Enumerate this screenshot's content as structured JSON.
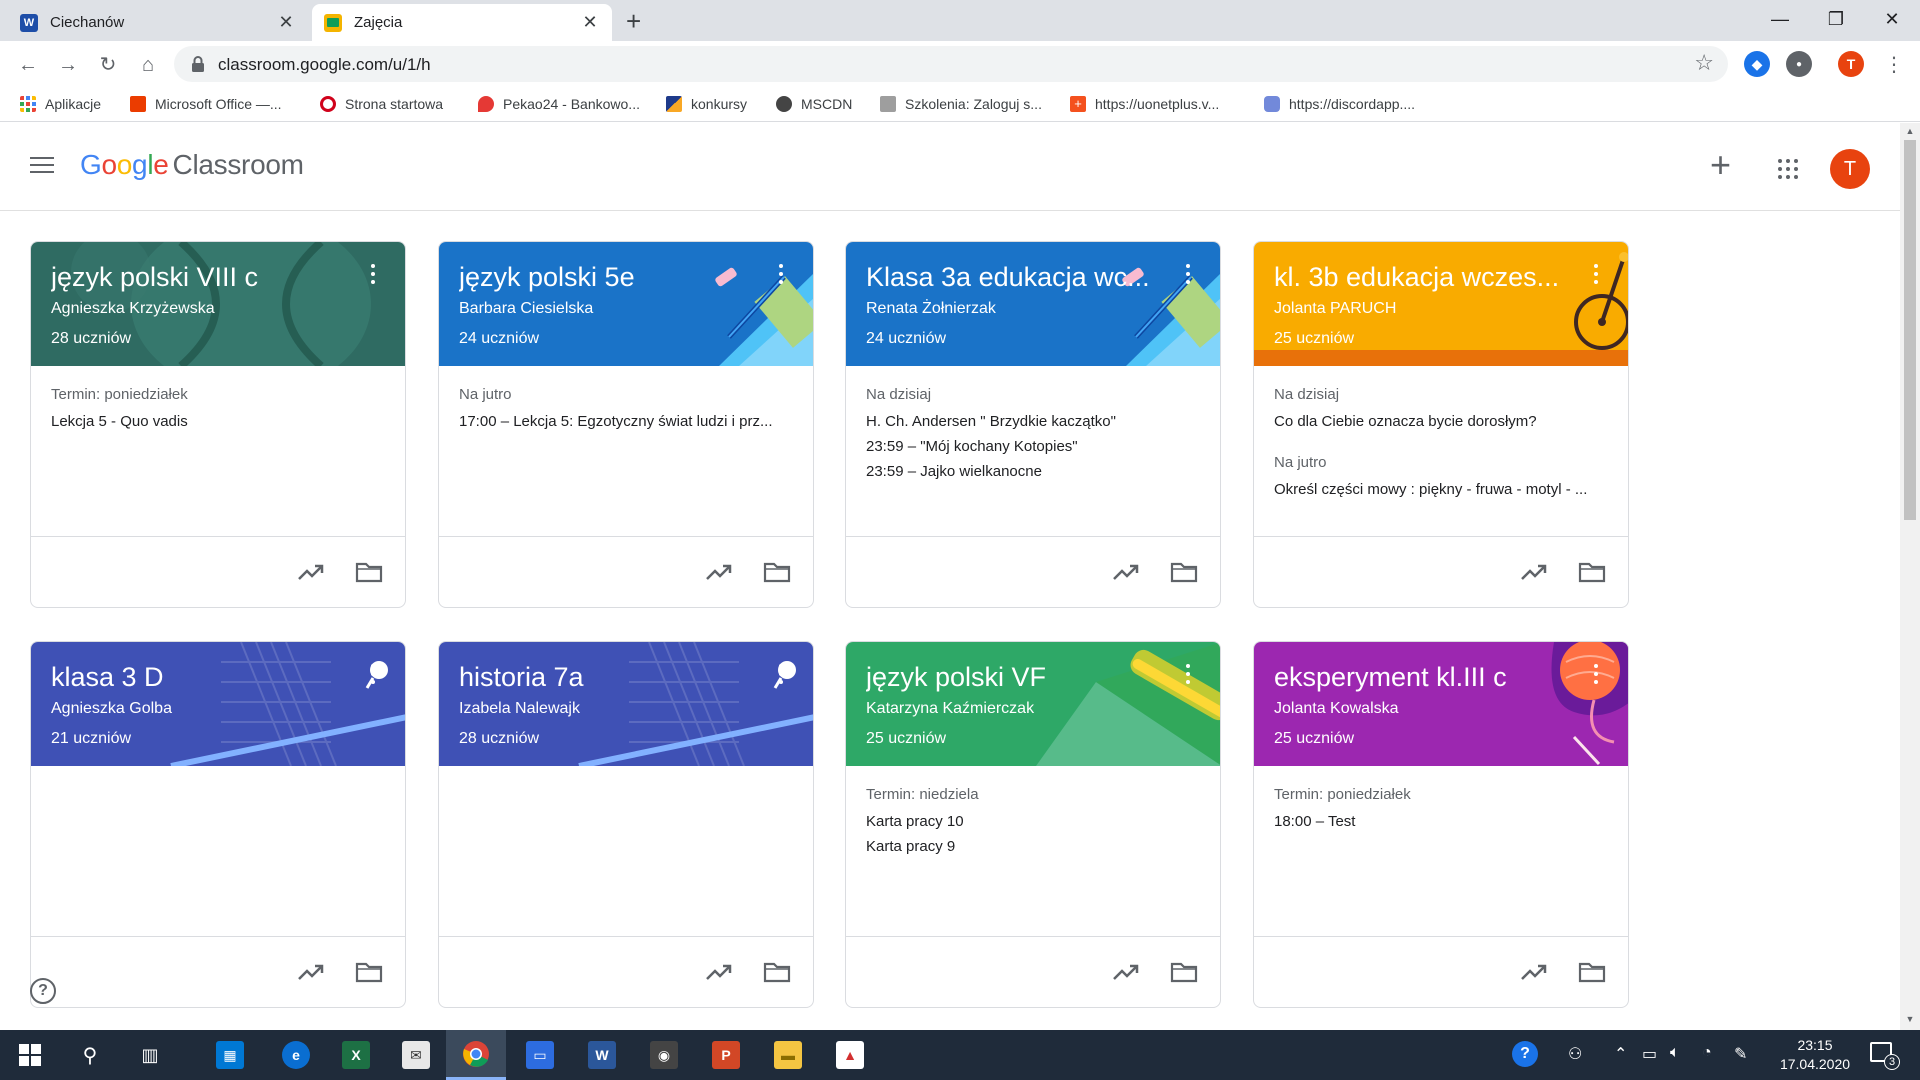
{
  "browser": {
    "tabs": [
      {
        "title": "Ciechanów",
        "active": false
      },
      {
        "title": "Zajęcia",
        "active": true
      }
    ],
    "url": "classroom.google.com/u/1/h",
    "profile_initial": "T",
    "bookmarks": [
      {
        "label": "Aplikacje",
        "icon": "apps-grid-icon",
        "color": "#ea4335"
      },
      {
        "label": "Microsoft Office —...",
        "icon": "office-icon",
        "color": "#eb3c00"
      },
      {
        "label": "Strona startowa",
        "icon": "opera-icon",
        "color": "#d0021b"
      },
      {
        "label": "Pekao24 - Bankowo...",
        "icon": "pekao-icon",
        "color": "#e53935"
      },
      {
        "label": "konkursy",
        "icon": "books-icon",
        "color": "#1e3a8a"
      },
      {
        "label": "MSCDN",
        "icon": "mscdn-icon",
        "color": "#444444"
      },
      {
        "label": "Szkolenia: Zaloguj s...",
        "icon": "szkolenia-icon",
        "color": "#777777"
      },
      {
        "label": "https://uonetplus.v...",
        "icon": "uonet-icon",
        "color": "#f4511e"
      },
      {
        "label": "https://discordapp....",
        "icon": "discord-icon",
        "color": "#7289da"
      }
    ]
  },
  "app": {
    "logo_google": [
      "G",
      "o",
      "o",
      "g",
      "l",
      "e"
    ],
    "logo_product": "Classroom",
    "avatar_initial": "T"
  },
  "courses": [
    {
      "title": "język polski VIII c",
      "teacher": "Agnieszka Krzyżewska",
      "students": "28 uczniów",
      "theme": "#2f6b62",
      "sections": [
        {
          "label": "Termin: poniedziałek",
          "items": [
            "Lekcja 5 - Quo vadis"
          ]
        }
      ]
    },
    {
      "title": "język polski 5e",
      "teacher": "Barbara Ciesielska",
      "students": "24 uczniów",
      "theme": "#1a73c8",
      "sections": [
        {
          "label": "Na jutro",
          "items": [
            "17:00 – Lekcja 5: Egzotyczny świat ludzi i prz..."
          ]
        }
      ]
    },
    {
      "title": "Klasa 3a edukacja wc...",
      "teacher": "Renata Żołnierzak",
      "students": "24 uczniów",
      "theme": "#1a73c8",
      "sections": [
        {
          "label": "Na dzisiaj",
          "items": [
            "H. Ch. Andersen \" Brzydkie kaczątko\"",
            "23:59 – \"Mój kochany Kotopies\"",
            "23:59 – Jajko wielkanocne"
          ]
        }
      ]
    },
    {
      "title": "kl. 3b edukacja wczes...",
      "teacher": "Jolanta PARUCH",
      "students": "25 uczniów",
      "theme": "#f9ab00",
      "sections": [
        {
          "label": "Na dzisiaj",
          "items": [
            "Co dla Ciebie oznacza bycie dorosłym?"
          ]
        },
        {
          "label": "Na jutro",
          "items": [
            "Określ części mowy : piękny - fruwa - motyl - ..."
          ]
        }
      ]
    },
    {
      "title": "klasa 3 D",
      "teacher": "Agnieszka Golba",
      "students": "21 uczniów",
      "theme": "#3f51b5",
      "sections": []
    },
    {
      "title": "historia 7a",
      "teacher": "Izabela Nalewajk",
      "students": "28 uczniów",
      "theme": "#3f51b5",
      "sections": []
    },
    {
      "title": "język polski VF",
      "teacher": "Katarzyna Kaźmierczak",
      "students": "25 uczniów",
      "theme": "#2ea867",
      "sections": [
        {
          "label": "Termin: niedziela",
          "items": [
            "Karta pracy 10",
            "Karta pracy 9"
          ]
        }
      ]
    },
    {
      "title": "eksperyment kl.III c",
      "teacher": "Jolanta Kowalska",
      "students": "25 uczniów",
      "theme": "#9c27b0",
      "sections": [
        {
          "label": "Termin: poniedziałek",
          "items": [
            "18:00 – Test"
          ]
        }
      ]
    }
  ],
  "taskbar": {
    "time": "23:15",
    "date": "17.04.2020",
    "notifications": "3"
  }
}
